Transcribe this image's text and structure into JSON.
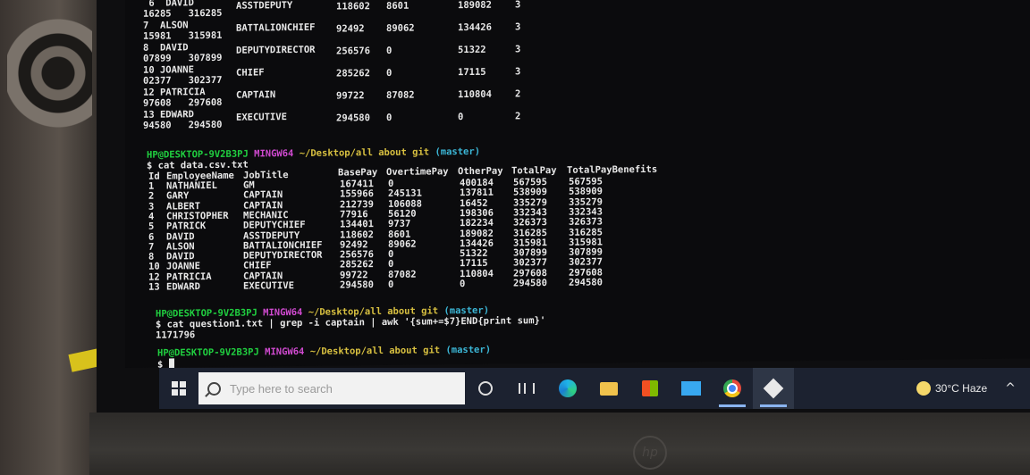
{
  "terminal": {
    "top_rows": [
      {
        "l1": " 6  DAVID",
        "l2": "16285   316285",
        "job": "ASSTDEPUTY",
        "base": "118602",
        "ot": "8601",
        "other": "189082",
        "cnt": "3"
      },
      {
        "l1": "7  ALSON",
        "l2": "15981   315981",
        "job": "BATTALIONCHIEF",
        "base": "92492",
        "ot": "89062",
        "other": "134426",
        "cnt": "3"
      },
      {
        "l1": "8  DAVID",
        "l2": "07899   307899",
        "job": "DEPUTYDIRECTOR",
        "base": "256576",
        "ot": "0",
        "other": "51322",
        "cnt": "3"
      },
      {
        "l1": "10 JOANNE",
        "l2": "02377   302377",
        "job": "CHIEF",
        "base": "285262",
        "ot": "0",
        "other": "17115",
        "cnt": "3"
      },
      {
        "l1": "12 PATRICIA",
        "l2": "97608   297608",
        "job": "CAPTAIN",
        "base": "99722",
        "ot": "87082",
        "other": "110804",
        "cnt": "2"
      },
      {
        "l1": "13 EDWARD",
        "l2": "94580   294580",
        "job": "EXECUTIVE",
        "base": "294580",
        "ot": "0",
        "other": "0",
        "cnt": "2"
      }
    ],
    "prompt": {
      "user": "HP@DESKTOP-9V2B3PJ",
      "sys": "MINGW64",
      "path": "~/Desktop/all about git",
      "branch": "(master)"
    },
    "cmd1": "$ cat data.csv.txt",
    "headers": [
      "Id",
      "EmployeeName",
      "JobTitle",
      "BasePay",
      "OvertimePay",
      "OtherPay",
      "TotalPay",
      "TotalPayBenefits"
    ],
    "rows": [
      [
        "1",
        "NATHANIEL",
        "GM",
        "167411",
        "0",
        "400184",
        "567595",
        "567595"
      ],
      [
        "2",
        "GARY",
        "CAPTAIN",
        "155966",
        "245131",
        "137811",
        "538909",
        "538909"
      ],
      [
        "3",
        "ALBERT",
        "CAPTAIN",
        "212739",
        "106088",
        "16452",
        "335279",
        "335279"
      ],
      [
        "4",
        "CHRISTOPHER",
        "MECHANIC",
        "77916",
        "56120",
        "198306",
        "332343",
        "332343"
      ],
      [
        "5",
        "PATRICK",
        "DEPUTYCHIEF",
        "134401",
        "9737",
        "182234",
        "326373",
        "326373"
      ],
      [
        "6",
        "DAVID",
        "ASSTDEPUTY",
        "118602",
        "8601",
        "189082",
        "316285",
        "316285"
      ],
      [
        "7",
        "ALSON",
        "BATTALIONCHIEF",
        "92492",
        "89062",
        "134426",
        "315981",
        "315981"
      ],
      [
        "8",
        "DAVID",
        "DEPUTYDIRECTOR",
        "256576",
        "0",
        "51322",
        "307899",
        "307899"
      ],
      [
        "10",
        "JOANNE",
        "CHIEF",
        "285262",
        "0",
        "17115",
        "302377",
        "302377"
      ],
      [
        "12",
        "PATRICIA",
        "CAPTAIN",
        "99722",
        "87082",
        "110804",
        "297608",
        "297608"
      ],
      [
        "13",
        "EDWARD",
        "EXECUTIVE",
        "294580",
        "0",
        "0",
        "294580",
        "294580"
      ]
    ],
    "cmd2": "$ cat question1.txt | grep -i captain | awk '{sum+=$7}END{print sum}'",
    "result": "1171796",
    "cmd3": "$ "
  },
  "taskbar": {
    "search_placeholder": "Type here to search",
    "weather": "30°C  Haze",
    "tray_chevron": "^"
  }
}
